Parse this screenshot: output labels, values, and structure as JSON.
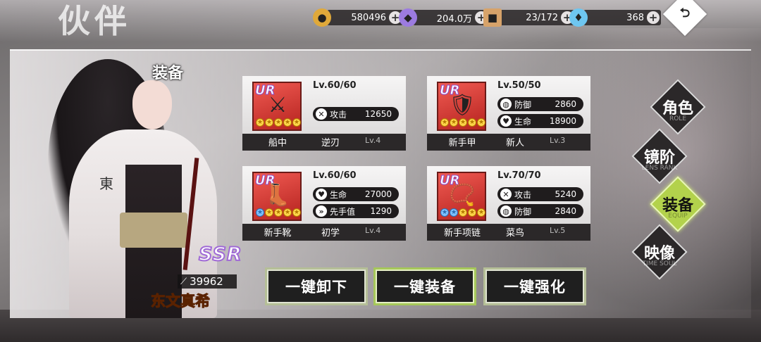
{
  "page": {
    "title": "伙伴"
  },
  "resources": [
    {
      "icon": "gold-coin-icon",
      "value": "580496",
      "color": "#e0a93a"
    },
    {
      "icon": "purple-crystal-icon",
      "value": "204.0万",
      "color": "#9c7be0"
    },
    {
      "icon": "supply-crate-icon",
      "value": "23/172",
      "color": "#d7a36a"
    },
    {
      "icon": "blue-diamond-icon",
      "value": "368",
      "color": "#6ec6f0"
    }
  ],
  "back_button": {
    "glyph": "⮌"
  },
  "section_title": "装备",
  "character": {
    "rarity": "SSR",
    "power": "39962",
    "name": "东文真希",
    "emblem": "東"
  },
  "equipment": [
    {
      "slot_name": "船中",
      "rarity": "UR",
      "level": "Lv.60/60",
      "art": "⚔",
      "stats": [
        {
          "icon": "sword-icon",
          "glyph": "✕",
          "label": "攻击",
          "value": "12650"
        }
      ],
      "stars": [
        "y",
        "y",
        "y",
        "y",
        "y"
      ],
      "subname": "逆刃",
      "sublevel": "Lv.4"
    },
    {
      "slot_name": "新手甲",
      "rarity": "UR",
      "level": "Lv.50/50",
      "art": "🛡",
      "stats": [
        {
          "icon": "shield-icon",
          "glyph": "◍",
          "label": "防御",
          "value": "2860"
        },
        {
          "icon": "heart-icon",
          "glyph": "♥",
          "label": "生命",
          "value": "18900"
        }
      ],
      "stars": [
        "y",
        "y",
        "y",
        "y",
        "y"
      ],
      "subname": "新人",
      "sublevel": "Lv.3"
    },
    {
      "slot_name": "新手靴",
      "rarity": "UR",
      "level": "Lv.60/60",
      "art": "👢",
      "stats": [
        {
          "icon": "heart-icon",
          "glyph": "♥",
          "label": "生命",
          "value": "27000"
        },
        {
          "icon": "speed-icon",
          "glyph": "»",
          "label": "先手值",
          "value": "1290"
        }
      ],
      "stars": [
        "b",
        "y",
        "y",
        "y",
        "y"
      ],
      "subname": "初学",
      "sublevel": "Lv.4"
    },
    {
      "slot_name": "新手项链",
      "rarity": "UR",
      "level": "Lv.70/70",
      "art": "📿",
      "stats": [
        {
          "icon": "sword-icon",
          "glyph": "✕",
          "label": "攻击",
          "value": "5240"
        },
        {
          "icon": "shield-icon",
          "glyph": "◍",
          "label": "防御",
          "value": "2840"
        }
      ],
      "stars": [
        "b",
        "b",
        "y",
        "y",
        "y"
      ],
      "subname": "菜鸟",
      "sublevel": "Lv.5"
    }
  ],
  "actions": [
    {
      "label": "一键卸下"
    },
    {
      "label": "一键装备"
    },
    {
      "label": "一键强化"
    }
  ],
  "tabs": [
    {
      "label": "角色",
      "sub": "ROLE",
      "active": false
    },
    {
      "label": "镜阶",
      "sub": "LENS RANK",
      "active": false
    },
    {
      "label": "装备",
      "sub": "EQUIP",
      "active": true
    },
    {
      "label": "映像",
      "sub": "TIME SOUL",
      "active": false
    }
  ]
}
